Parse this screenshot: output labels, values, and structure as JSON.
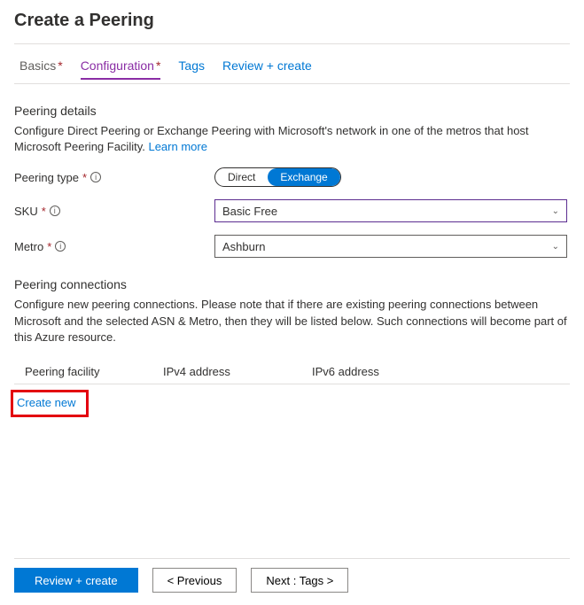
{
  "title": "Create a Peering",
  "tabs": {
    "basics": "Basics",
    "configuration": "Configuration",
    "tags": "Tags",
    "review": "Review + create"
  },
  "peering_details": {
    "heading": "Peering details",
    "description": "Configure Direct Peering or Exchange Peering with Microsoft's network in one of the metros that host Microsoft Peering Facility. ",
    "learn_more": "Learn more"
  },
  "fields": {
    "peering_type": {
      "label": "Peering type",
      "options": {
        "direct": "Direct",
        "exchange": "Exchange"
      },
      "selected": "exchange"
    },
    "sku": {
      "label": "SKU",
      "value": "Basic Free"
    },
    "metro": {
      "label": "Metro",
      "value": "Ashburn"
    }
  },
  "connections": {
    "heading": "Peering connections",
    "description": "Configure new peering connections. Please note that if there are existing peering connections between Microsoft and the selected ASN & Metro, then they will be listed below. Such connections will become part of this Azure resource.",
    "columns": {
      "facility": "Peering facility",
      "ipv4": "IPv4 address",
      "ipv6": "IPv6 address"
    },
    "create_new": "Create new"
  },
  "footer": {
    "review": "Review + create",
    "previous": "< Previous",
    "next": "Next : Tags >"
  }
}
